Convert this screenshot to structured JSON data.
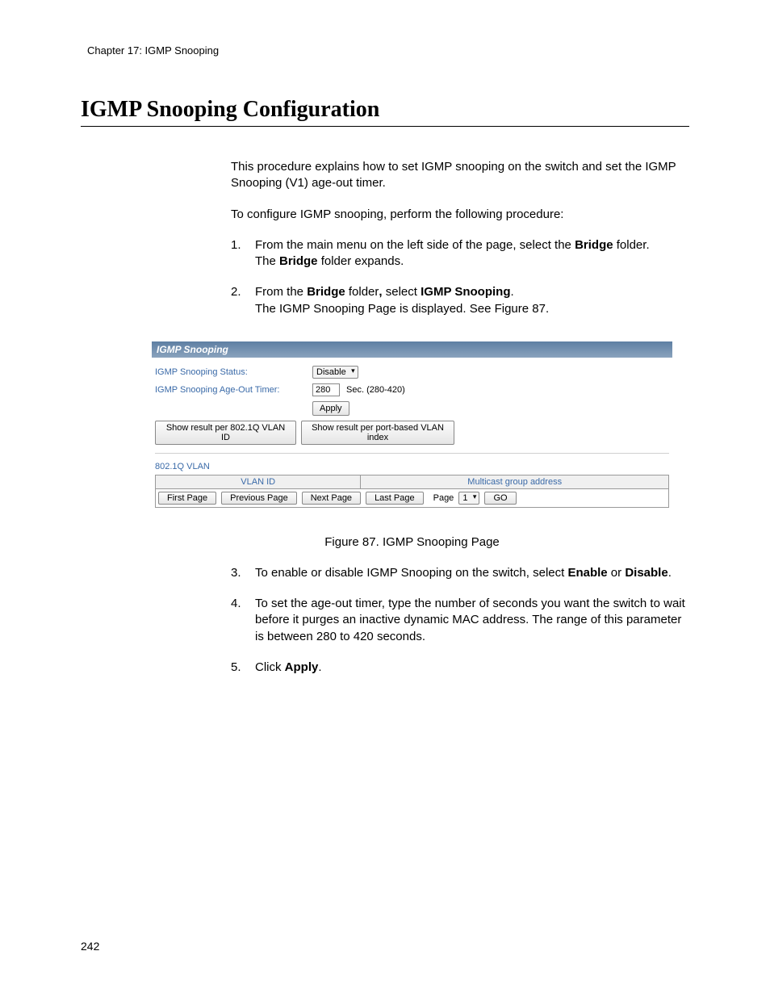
{
  "chapter_header": "Chapter 17: IGMP Snooping",
  "title": "IGMP Snooping Configuration",
  "intro_para": "This procedure explains how to set IGMP snooping on the switch and set the IGMP Snooping (V1) age-out timer.",
  "lead_in": "To configure IGMP snooping, perform the following procedure:",
  "steps_top": {
    "s1_a": "From the main menu on the left side of the page, select the ",
    "s1_bold": "Bridge",
    "s1_b": " folder.",
    "s1_c_a": "The ",
    "s1_c_bold": "Bridge",
    "s1_c_b": " folder expands.",
    "s2_a": "From the ",
    "s2_bold1": "Bridge",
    "s2_b": " folder",
    "s2_bold_comma": ",",
    "s2_c": " select ",
    "s2_bold2": "IGMP Snooping",
    "s2_d": ".",
    "s2_e": "The IGMP Snooping Page is displayed. See Figure 87."
  },
  "ui": {
    "panel_title": "IGMP Snooping",
    "status_label": "IGMP Snooping Status:",
    "status_value": "Disable",
    "timer_label": "IGMP Snooping Age-Out Timer:",
    "timer_value": "280",
    "timer_suffix": "Sec. (280-420)",
    "apply": "Apply",
    "show_8021q": "Show result per 802.1Q VLAN ID",
    "show_portbased": "Show result per port-based VLAN index",
    "vlan_section": "802.1Q VLAN",
    "col_vlan_id": "VLAN ID",
    "col_multicast": "Multicast group address",
    "pager": {
      "first": "First Page",
      "prev": "Previous Page",
      "next": "Next Page",
      "last": "Last Page",
      "page_label": "Page",
      "page_value": "1",
      "go": "GO"
    }
  },
  "figure_caption": "Figure 87. IGMP Snooping Page",
  "steps_bottom": {
    "s3_a": "To enable or disable IGMP Snooping on the switch, select ",
    "s3_bold1": "Enable",
    "s3_b": " or ",
    "s3_bold2": "Disable",
    "s3_c": ".",
    "s4": "To set the age-out timer, type the number of seconds you want the switch to wait before it purges an inactive dynamic MAC address. The range of this parameter is between 280 to 420 seconds.",
    "s5_a": "Click ",
    "s5_bold": "Apply",
    "s5_b": "."
  },
  "page_number": "242"
}
